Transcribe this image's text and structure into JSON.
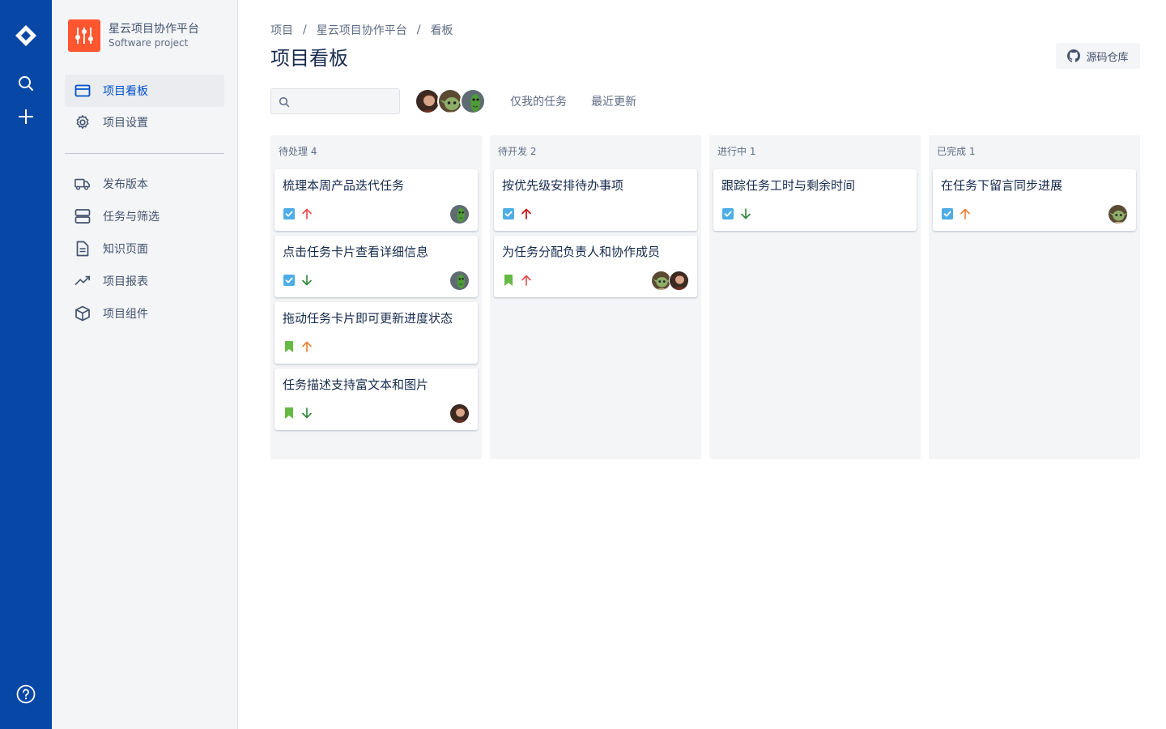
{
  "project": {
    "name": "星云项目协作平台",
    "type": "Software project"
  },
  "sidebar": {
    "items": [
      {
        "label": "项目看板",
        "icon": "board-icon",
        "active": true
      },
      {
        "label": "项目设置",
        "icon": "gear-icon"
      }
    ],
    "items2": [
      {
        "label": "发布版本",
        "icon": "truck-icon"
      },
      {
        "label": "任务与筛选",
        "icon": "stack-icon"
      },
      {
        "label": "知识页面",
        "icon": "page-icon"
      },
      {
        "label": "项目报表",
        "icon": "trend-icon"
      },
      {
        "label": "项目组件",
        "icon": "box-icon"
      }
    ]
  },
  "breadcrumb": [
    "项目",
    "星云项目协作平台",
    "看板"
  ],
  "page": {
    "title": "项目看板",
    "repo_label": "源码仓库"
  },
  "filters": {
    "search_value": "",
    "only_mine": "仅我的任务",
    "recent": "最近更新"
  },
  "colors": {
    "nav": "#0747a6",
    "accent": "#0052cc",
    "task": "#4fade6",
    "story": "#65ba43",
    "highest": "#cd1317",
    "high": "#e9494a",
    "medium": "#e97f33",
    "low": "#2d8738"
  },
  "board": {
    "columns": [
      {
        "title": "待处理 4",
        "cards": [
          {
            "title": "梳理本周产品迭代任务",
            "type": "task-icon",
            "priority": "high-priority-icon",
            "assignees": [
              "avatar-green"
            ]
          },
          {
            "title": "点击任务卡片查看详细信息",
            "type": "task-icon",
            "priority": "low-priority-icon",
            "assignees": [
              "avatar-green"
            ]
          },
          {
            "title": "拖动任务卡片即可更新进度状态",
            "type": "story-icon",
            "priority": "medium-priority-icon",
            "assignees": []
          },
          {
            "title": "任务描述支持富文本和图片",
            "type": "story-icon",
            "priority": "low-priority-icon",
            "assignees": [
              "avatar-red"
            ]
          }
        ]
      },
      {
        "title": "待开发 2",
        "cards": [
          {
            "title": "按优先级安排待办事项",
            "type": "task-icon",
            "priority": "highest-priority-icon",
            "assignees": []
          },
          {
            "title": "为任务分配负责人和协作成员",
            "type": "story-icon",
            "priority": "high-priority-icon",
            "assignees": [
              "avatar-yoda",
              "avatar-red"
            ]
          }
        ]
      },
      {
        "title": "进行中 1",
        "cards": [
          {
            "title": "跟踪任务工时与剩余时间",
            "type": "task-icon",
            "priority": "low-priority-icon",
            "assignees": []
          }
        ]
      },
      {
        "title": "已完成 1",
        "cards": [
          {
            "title": "在任务下留言同步进展",
            "type": "task-icon",
            "priority": "medium-priority-icon",
            "assignees": [
              "avatar-yoda"
            ]
          }
        ]
      }
    ]
  }
}
